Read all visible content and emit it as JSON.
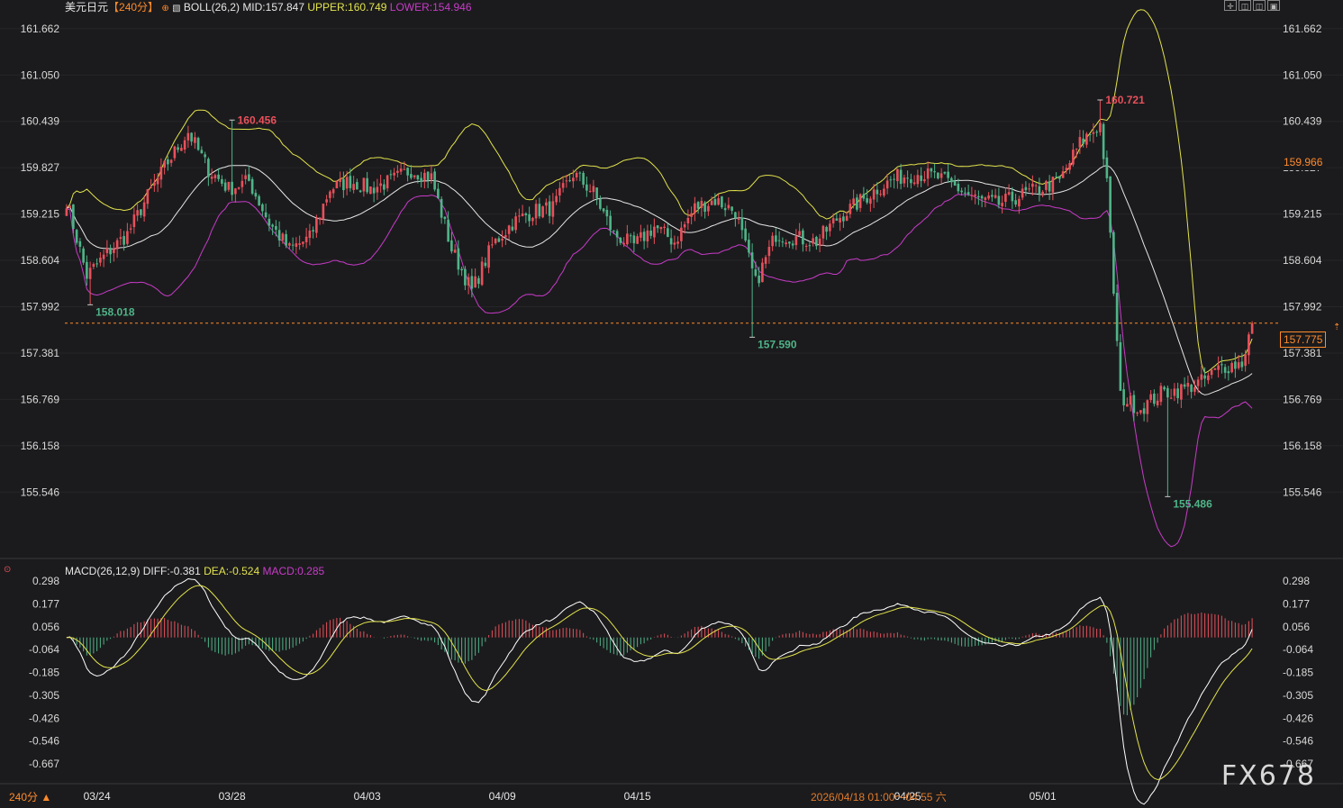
{
  "header": {
    "symbol": "美元日元",
    "timeframe": "【240分】",
    "boll_label": "BOLL(26,2)",
    "mid": "MID:157.847",
    "upper": "UPPER:160.749",
    "lower": "LOWER:154.946"
  },
  "macd_header": {
    "label": "MACD(26,12,9)",
    "diff": "DIFF:-0.381",
    "dea": "DEA:-0.524",
    "macd": "MACD:0.285"
  },
  "footer": {
    "timeframe": "240分 ▲",
    "cursor_time": "2026/04/18 01:00～04:55 六",
    "watermark": "FX678"
  },
  "colors": {
    "up": "#e8505b",
    "down": "#4fb488",
    "upper": "#e3e34d",
    "lower": "#c83bc8",
    "mid": "#e6e6e6",
    "diff": "#ffffff",
    "dea": "#e3e34d",
    "current": "#ff8a2a"
  },
  "chart_data": [
    {
      "type": "candlestick",
      "title": "美元日元【240分】",
      "x_ticks": [
        "03/24",
        "03/28",
        "04/03",
        "04/09",
        "04/15",
        "04/25",
        "05/01"
      ],
      "y_ticks": [
        161.662,
        161.05,
        160.439,
        159.827,
        159.215,
        158.604,
        157.992,
        157.381,
        156.769,
        156.158,
        155.546
      ],
      "ylim": [
        155.3,
        161.85
      ],
      "current_price": 157.775,
      "right_labels": [
        "159.966",
        "157.775"
      ],
      "annotations": [
        {
          "text": "158.018",
          "value": 158.018,
          "type": "low"
        },
        {
          "text": "160.456",
          "value": 160.456,
          "type": "high"
        },
        {
          "text": "157.590",
          "value": 157.59,
          "type": "low"
        },
        {
          "text": "160.721",
          "value": 160.721,
          "type": "high"
        },
        {
          "text": "155.486",
          "value": 155.486,
          "type": "low"
        }
      ],
      "anchors": [
        [
          0,
          159.4
        ],
        [
          6,
          158.4
        ],
        [
          12,
          158.7
        ],
        [
          18,
          158.95
        ],
        [
          24,
          159.45
        ],
        [
          30,
          159.9
        ],
        [
          36,
          160.3
        ],
        [
          42,
          159.8
        ],
        [
          48,
          159.55
        ],
        [
          54,
          159.65
        ],
        [
          60,
          159.1
        ],
        [
          66,
          158.75
        ],
        [
          72,
          158.9
        ],
        [
          78,
          159.55
        ],
        [
          84,
          159.65
        ],
        [
          90,
          159.55
        ],
        [
          96,
          159.65
        ],
        [
          102,
          159.8
        ],
        [
          108,
          159.7
        ],
        [
          114,
          158.75
        ],
        [
          120,
          158.2
        ],
        [
          126,
          158.8
        ],
        [
          132,
          159.1
        ],
        [
          138,
          159.25
        ],
        [
          144,
          159.3
        ],
        [
          150,
          159.75
        ],
        [
          156,
          159.5
        ],
        [
          162,
          158.95
        ],
        [
          168,
          158.8
        ],
        [
          174,
          159.05
        ],
        [
          180,
          158.85
        ],
        [
          186,
          159.3
        ],
        [
          192,
          159.4
        ],
        [
          198,
          159.25
        ],
        [
          204,
          158.3
        ],
        [
          210,
          158.95
        ],
        [
          216,
          158.9
        ],
        [
          222,
          158.85
        ],
        [
          228,
          159.15
        ],
        [
          234,
          159.35
        ],
        [
          240,
          159.55
        ],
        [
          246,
          159.7
        ],
        [
          252,
          159.75
        ],
        [
          258,
          159.7
        ],
        [
          264,
          159.55
        ],
        [
          270,
          159.4
        ],
        [
          276,
          159.35
        ],
        [
          282,
          159.45
        ],
        [
          288,
          159.55
        ],
        [
          294,
          159.65
        ],
        [
          300,
          160.15
        ],
        [
          306,
          160.4
        ],
        [
          308,
          159.6
        ],
        [
          312,
          156.8
        ],
        [
          318,
          156.65
        ],
        [
          324,
          156.85
        ],
        [
          330,
          156.9
        ],
        [
          336,
          157.0
        ],
        [
          342,
          157.2
        ],
        [
          348,
          157.25
        ],
        [
          351,
          157.775
        ]
      ],
      "lows_highs": [
        {
          "i": 7,
          "low": 158.018
        },
        {
          "i": 49,
          "high": 160.456
        },
        {
          "i": 203,
          "low": 157.59
        },
        {
          "i": 306,
          "high": 160.721
        },
        {
          "i": 326,
          "low": 155.486
        }
      ],
      "series": [
        {
          "name": "MID",
          "value": 157.847
        },
        {
          "name": "UPPER",
          "value": 160.749
        },
        {
          "name": "LOWER",
          "value": 154.946
        }
      ]
    },
    {
      "type": "bar",
      "title": "MACD(26,12,9)",
      "y_ticks": [
        0.298,
        0.177,
        0.056,
        -0.064,
        -0.185,
        -0.305,
        -0.426,
        -0.546,
        -0.667
      ],
      "ylim": [
        -0.75,
        0.31
      ],
      "series": [
        {
          "name": "DIFF",
          "value": -0.381
        },
        {
          "name": "DEA",
          "value": -0.524
        },
        {
          "name": "MACD",
          "value": 0.285
        }
      ]
    }
  ]
}
